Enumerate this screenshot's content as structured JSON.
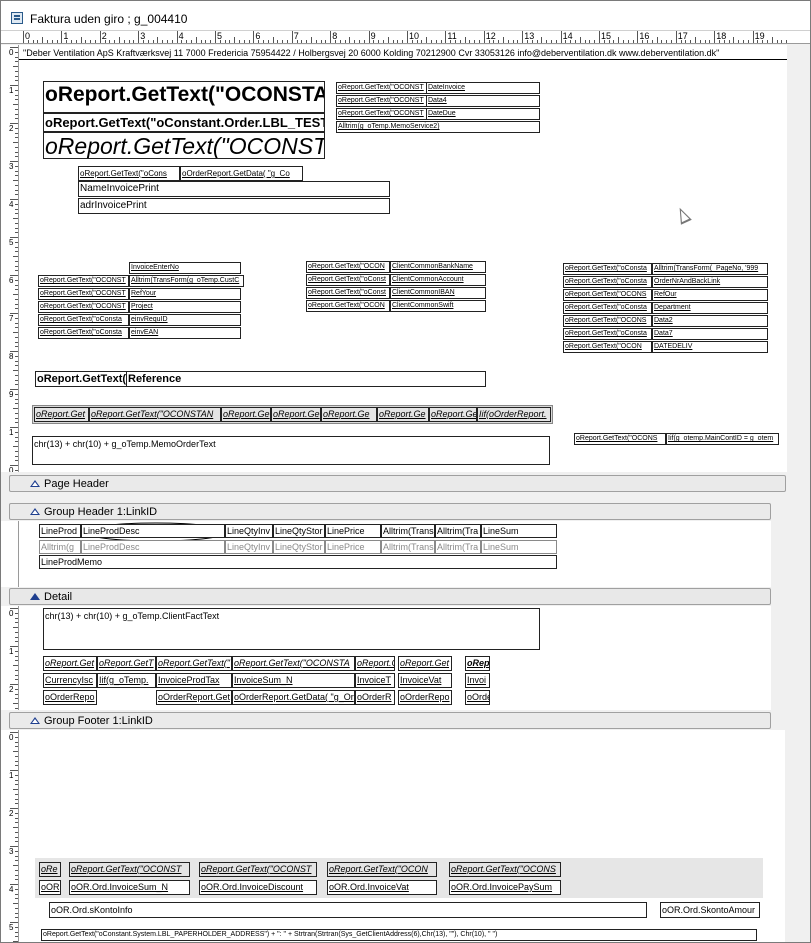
{
  "window": {
    "title": "Faktura uden giro ; g_004410"
  },
  "ruler": {
    "marks": [
      "0",
      "1",
      "2",
      "3",
      "4",
      "5",
      "6",
      "7",
      "8",
      "9",
      "10",
      "11",
      "12",
      "13",
      "14",
      "15",
      "16",
      "17",
      "18",
      "19"
    ]
  },
  "report_header": {
    "vruler": [
      "0",
      "1",
      "2",
      "3",
      "4",
      "5",
      "6",
      "7",
      "8",
      "9",
      "1",
      "0"
    ],
    "company_line": "\"Deber Ventilation ApS Kraftværksvej 11 7000 Fredericia 75954422  /   Holbergsvej 20 6000 Kolding 70212900    Cvr 33053126    info@deberventilation.dk    www.deberventilation.dk\"",
    "title_big": "oReport.GetText(\"OCONSTAN",
    "title_mid": "oReport.GetText(\"oConstant.Order.LBL_TEST",
    "title_italic": "oReport.GetText(\"OCONSTA",
    "info_labels": [
      "oReport.GetText(\"OCONST",
      "oReport.GetText(\"OCONST",
      "oReport.GetText(\"OCONST"
    ],
    "info_values": [
      "DateInvoice",
      "Data4",
      "DateDue"
    ],
    "memo_service": "Alltrim(g_oTemp.MemoService2)",
    "addr_label": "oReport.GetText(\"oCons",
    "addr_data": "oOrderReport.GetData( \"g_Co",
    "name_invoice": "NameInvoicePrint",
    "addr_invoice": "adrInvoicePrint",
    "left_labels": [
      "oReport.GetText(\"OCONST",
      "oReport.GetText(\"OCONST",
      "oReport.GetText(\"OCONST",
      "oReport.GetText(\"oConsta",
      "oReport.GetText(\"oConsta"
    ],
    "left_values": [
      "InvoiceEnterNo",
      "Alltrim(TransForm(g_oTemp.CustC",
      "RefYour",
      "Project",
      "einvRequID",
      "einvEAN"
    ],
    "mid_labels": [
      "oReport.GetText(\"OCON",
      "oReport.GetText(\"oConst",
      "oReport.GetText(\"oConst",
      "oReport.GetText(\"OCON"
    ],
    "mid_values": [
      "ClientCommonBankName",
      "ClientCommonAccount",
      "ClientCommonIBAN",
      "ClientCommonSwift"
    ],
    "right_labels": [
      "oReport.GetText(\"oConsta",
      "oReport.GetText(\"oConsta",
      "oReport.GetText(\"OCONS",
      "oReport.GetText(\"oConsta",
      "oReport.GetText(\"OCONS",
      "oReport.GetText(\"oConsta",
      "oReport.GetText(\"OCON"
    ],
    "right_values": [
      "Alltrim(TransForm(_PageNo, '999",
      "OrderNrAndBackLink",
      "RefOur",
      "Department",
      "Data2",
      "Data7",
      "DATEDELIV"
    ],
    "ref_label": "oReport.GetText(",
    "ref_value": "Reference",
    "col_headers": [
      "oReport.Get",
      "oReport.GetText(\"OCONSTAN",
      "oReport.Ge",
      "oReport.Ge",
      "oReport.Ge",
      "oReport.Ge",
      "oReport.Ge",
      "Iif(oOrderReport."
    ],
    "memo_order": "chr(13) + chr(10) + g_oTemp.MemoOrderText",
    "mainc_label": "oReport.GetText(\"OCONS",
    "mainc_value": "Iif(g_otemp.MainContID = g_otem"
  },
  "bands": {
    "page_header": "Page Header",
    "group_header": "Group Header 1:LinkID",
    "detail": "Detail",
    "group_footer": "Group Footer 1:LinkID"
  },
  "group_header": {
    "row1": [
      "LineProd",
      "LineProdDesc",
      "LineQtyInv",
      "LineQtyStor",
      "LinePrice",
      "Alltrim(Trans",
      "Alltrim(Tra",
      "LineSum"
    ],
    "row2": [
      "Alltrim(g",
      "LineProdDesc",
      "LineQtyInv",
      "LineQtyStor",
      "LinePrice",
      "Alltrim(Trans",
      "Alltrim(Tra",
      "LineSum"
    ],
    "memo": "LineProdMemo"
  },
  "detail": {
    "vruler": [
      "0",
      "1",
      "2"
    ],
    "client_fact": "chr(13) + chr(10) + g_oTemp.ClientFactText",
    "row1": [
      "oReport.Get",
      "oReport.GetT",
      "oReport.GetText(\"",
      "oReport.GetText(\"OCONSTA",
      "oReport.C",
      "oReport.Get",
      "oRep"
    ],
    "row2": [
      "CurrencyIsc",
      "Iif(g_oTemp.",
      "InvoiceProdTax",
      "InvoiceSum_N",
      "InvoiceT",
      "InvoiceVat",
      "Invoi"
    ],
    "row3": [
      "oOrderRepo",
      "oOrderReport.Get",
      "oOrderReport.GetData( \"g_Or",
      "oOrderR",
      "oOrderRepo",
      "oOrde"
    ]
  },
  "group_footer": {
    "vruler": [
      "0",
      "1",
      "2",
      "3",
      "4",
      "5"
    ],
    "row1": [
      "oRe",
      "oReport.GetText(\"OCONST",
      "oReport.GetText(\"OCONST",
      "oReport.GetText(\"OCON",
      "oReport.GetText(\"OCONS"
    ],
    "row2": [
      "oOR",
      "oOR.Ord.InvoiceSum_N",
      "oOR.Ord.InvoiceDiscount",
      "oOR.Ord.InvoiceVat",
      "oOR.Ord.InvoicePaySum"
    ],
    "skonto_info": "oOR.Ord.sKontoInfo",
    "skonto_amount": "oOR.Ord.SkontoAmour",
    "paper_address": "oReport.GetText(\"oConstant.System.LBL_PAPERHOLDER_ADDRESS\") + \": \" + Strtran(Strtran(Sys_GetClientAddress(6),Chr(13), \"\"), Chr(10), \" \")"
  }
}
